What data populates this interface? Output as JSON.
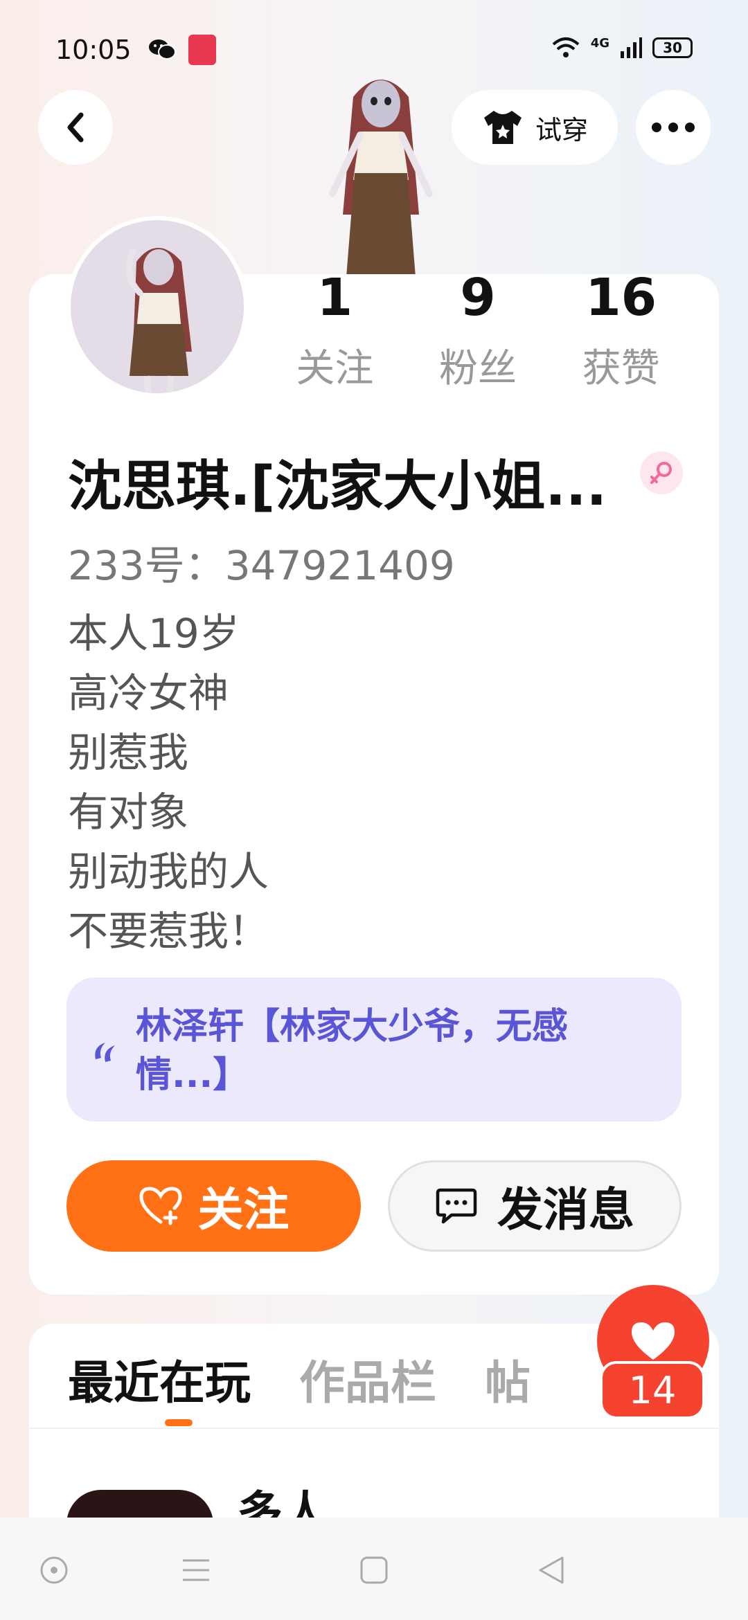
{
  "status_bar": {
    "time": "10:05",
    "network": "4G",
    "battery": "30"
  },
  "header": {
    "tryon_label": "试穿"
  },
  "profile": {
    "stats": [
      {
        "value": "1",
        "label": "关注"
      },
      {
        "value": "9",
        "label": "粉丝"
      },
      {
        "value": "16",
        "label": "获赞"
      }
    ],
    "name": "沈思琪.[沈家大小姐...",
    "id_line": "233号：347921409",
    "bio": [
      "本人19岁",
      "高冷女神",
      "别惹我",
      "有对象",
      "别动我的人",
      "不要惹我！"
    ],
    "partner": "林泽轩【林家大少爷，无感情...】",
    "follow_label": "关注",
    "message_label": "发消息"
  },
  "tabs": {
    "items": [
      "最近在玩",
      "作品栏",
      "帖"
    ],
    "game_title": "多人..."
  },
  "like": {
    "count": "14"
  },
  "colors": {
    "accent": "#ff7114",
    "like": "#f5432f",
    "partner_text": "#5a55d6",
    "partner_bg": "#ebe9fb"
  },
  "icons": {
    "back": "chevron-left-icon",
    "tryon": "tshirt-icon",
    "more": "more-dots-icon",
    "gender": "female-icon",
    "follow": "heart-plus-icon",
    "message": "chat-bubble-icon",
    "like": "heart-icon"
  }
}
